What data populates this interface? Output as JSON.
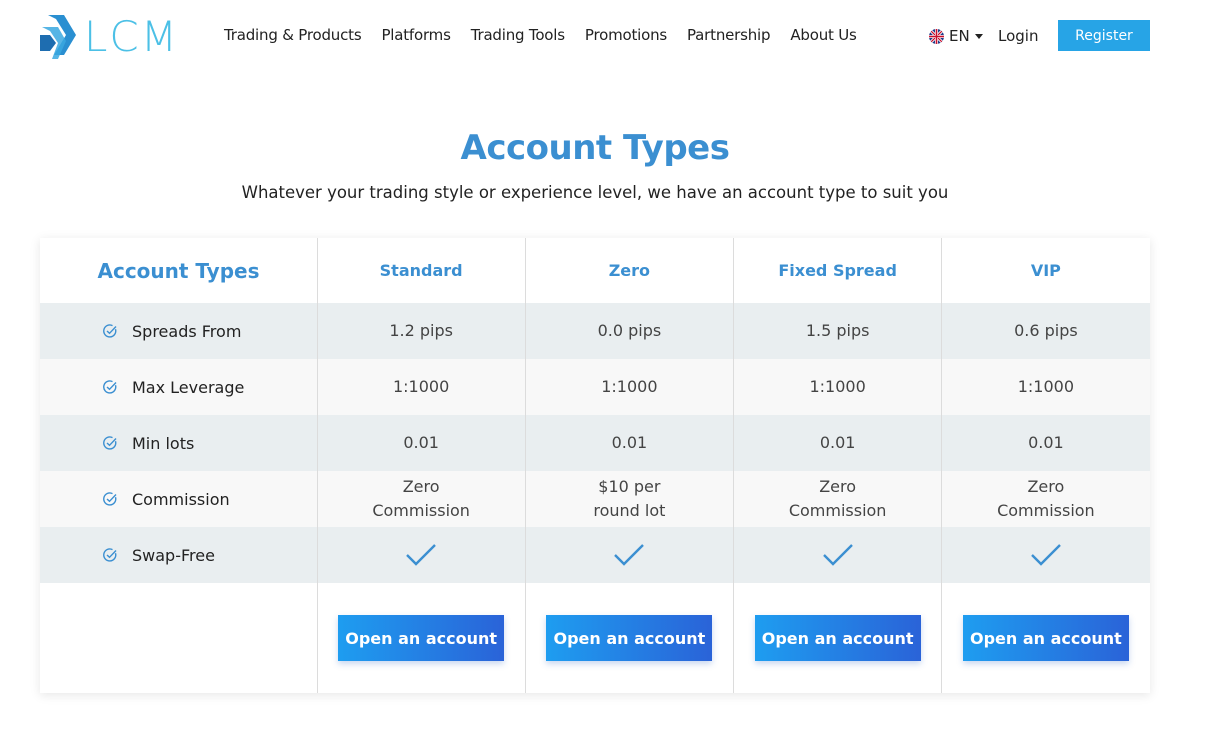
{
  "header": {
    "logo_text": "LCM",
    "nav": [
      "Trading & Products",
      "Platforms",
      "Trading Tools",
      "Promotions",
      "Partnership",
      "About Us"
    ],
    "language": "EN",
    "login_label": "Login",
    "register_label": "Register"
  },
  "page": {
    "title": "Account Types",
    "subtitle": "Whatever your trading style or experience level, we have an account type to suit you"
  },
  "table": {
    "header_label": "Account Types",
    "columns": [
      "Standard",
      "Zero",
      "Fixed Spread",
      "VIP"
    ],
    "rows": [
      {
        "label": "Spreads From",
        "values": [
          "1.2 pips",
          "0.0 pips",
          "1.5 pips",
          "0.6 pips"
        ]
      },
      {
        "label": "Max Leverage",
        "values": [
          "1:1000",
          "1:1000",
          "1:1000",
          "1:1000"
        ]
      },
      {
        "label": "Min lots",
        "values": [
          "0.01",
          "0.01",
          "0.01",
          "0.01"
        ]
      },
      {
        "label": "Commission",
        "values": [
          [
            "Zero",
            "Commission"
          ],
          [
            "$10 per",
            "round lot"
          ],
          [
            "Zero",
            "Commission"
          ],
          [
            "Zero",
            "Commission"
          ]
        ]
      },
      {
        "label": "Swap-Free",
        "values": [
          "check",
          "check",
          "check",
          "check"
        ]
      }
    ],
    "button_label": "Open an account"
  },
  "colors": {
    "accent": "#3b8fd1",
    "register_bg": "#27a4e6",
    "row_gray": "#e9eef0",
    "row_light": "#f8f8f8"
  },
  "icons": {
    "row_icon": "check-circle-icon",
    "swap_icon": "checkmark-icon",
    "flag_icon": "uk-flag-icon"
  }
}
